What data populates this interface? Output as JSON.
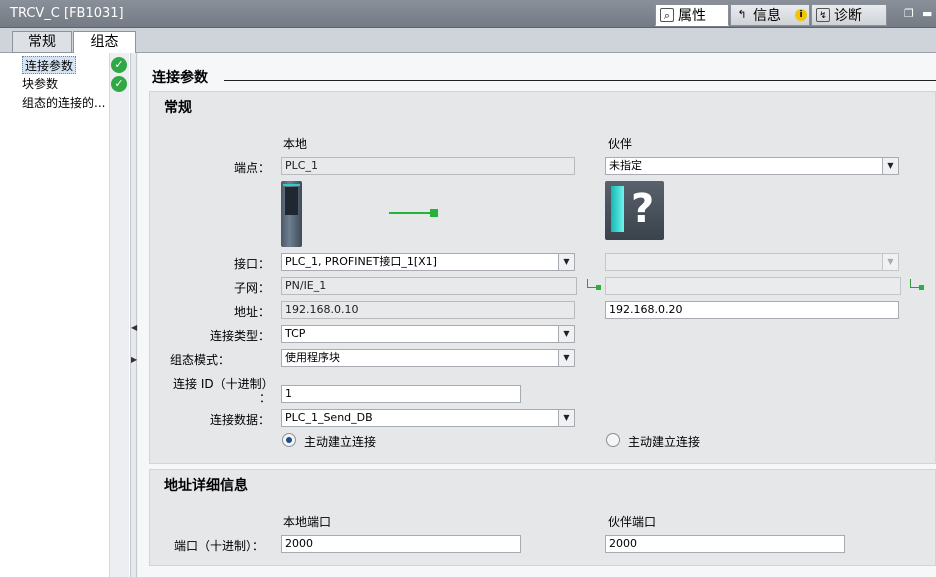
{
  "window": {
    "title": "TRCV_C [FB1031]"
  },
  "right_tabs": [
    {
      "label": "属性",
      "icon": "properties-icon"
    },
    {
      "label": "信息",
      "icon": "info-icon"
    },
    {
      "label": "诊断",
      "icon": "diagnostics-icon"
    }
  ],
  "sub_tabs": [
    "常规",
    "组态"
  ],
  "nav": {
    "items": [
      {
        "label": "连接参数",
        "status": "check"
      },
      {
        "label": "块参数",
        "status": "check"
      },
      {
        "label": "组态的连接的..."
      }
    ]
  },
  "section_title": "连接参数",
  "general": {
    "title": "常规",
    "local_header": "本地",
    "partner_header": "伙伴",
    "endpoint_label": "端点：",
    "local_endpoint": "PLC_1",
    "partner_endpoint": "未指定",
    "interface_label": "接口：",
    "local_interface": "PLC_1, PROFINET接口_1[X1]",
    "partner_interface": "",
    "subnet_label": "子网：",
    "local_subnet": "PN/IE_1",
    "partner_subnet": "",
    "address_label": "地址：",
    "local_address": "192.168.0.10",
    "partner_address": "192.168.0.20",
    "conn_type_label": "连接类型：",
    "conn_type": "TCP",
    "config_mode_label": "组态模式：",
    "config_mode": "使用程序块",
    "conn_id_label": "连接 ID（十进制）",
    "conn_id_colon": "：",
    "conn_id": "1",
    "conn_data_label": "连接数据：",
    "conn_data": "PLC_1_Send_DB",
    "local_active_label": "主动建立连接",
    "partner_active_label": "主动建立连接"
  },
  "addr_detail": {
    "title": "地址详细信息",
    "local_port_header": "本地端口",
    "partner_port_header": "伙伴端口",
    "port_label": "端口（十进制）：",
    "local_port": "2000",
    "partner_port": "2000"
  },
  "colors": {
    "check": "#2fa845",
    "link": "#27b33a",
    "module_teal": "#2ad0c8"
  }
}
